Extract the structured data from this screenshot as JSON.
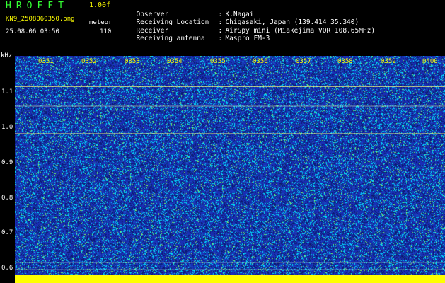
{
  "app": {
    "title": "HROFFT",
    "version": "1.00f"
  },
  "file": {
    "name": "KN9_2508060350.png",
    "datetime": "25.08.06 03:50"
  },
  "meteor": {
    "label": "meteor",
    "count": "110"
  },
  "info": [
    {
      "label": "Observer",
      "value": "K.Nagai"
    },
    {
      "label": "Receiving Location",
      "value": "Chigasaki, Japan (139.414 35.340)"
    },
    {
      "label": "Receiver",
      "value": "AirSpy mini (Miakejima VOR 108.65MHz)"
    },
    {
      "label": "Receiving antenna",
      "value": "Maspro FM-3"
    }
  ],
  "info_separator": ":",
  "axis": {
    "y_unit": "kHz",
    "y_ticks": [
      "1.1",
      "1.0",
      "0.9",
      "0.8",
      "0.7",
      "0.6"
    ],
    "x_ticks": [
      "0351",
      "0352",
      "0353",
      "0354",
      "0355",
      "0356",
      "0357",
      "0358",
      "0359",
      "0400"
    ]
  },
  "colors": {
    "background": "#000000",
    "waterfall_base": "#1a2fb8",
    "speckle_cyan": "#00e5ff",
    "speckle_green": "#7cff6a",
    "speckle_navy": "#0a1a6e",
    "carrier_line": "#ffff80",
    "bottom_band": "#ffff00",
    "label_yellow": "#ffff00",
    "label_white": "#ffffff",
    "title_green": "#33ff33"
  }
}
